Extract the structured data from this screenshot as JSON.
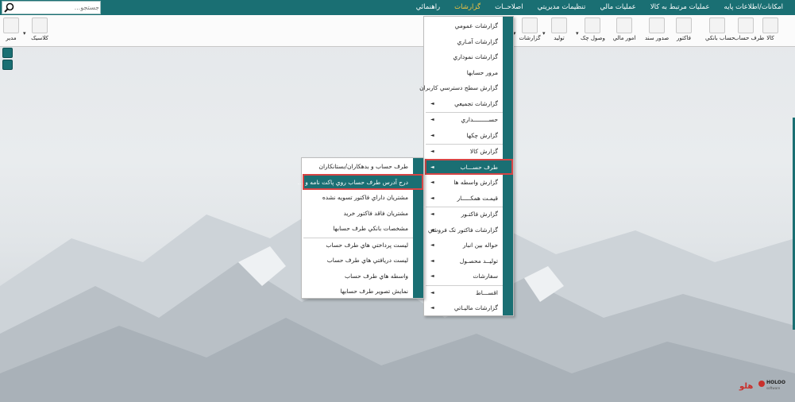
{
  "menubar": {
    "items": [
      {
        "label": "امکانات/اطلاعات پايه",
        "active": false
      },
      {
        "label": "عمليات مرتبط به کالا",
        "active": false
      },
      {
        "label": "عمليات مالي",
        "active": false
      },
      {
        "label": "تنظيمات مديريتي",
        "active": false
      },
      {
        "label": "اصلاحــات",
        "active": false
      },
      {
        "label": "گزارشات",
        "active": true
      },
      {
        "label": "راهنمائي",
        "active": false
      }
    ],
    "search_placeholder": "جستجو..."
  },
  "toolbar": {
    "buttons": [
      {
        "label": "کالا",
        "icon": "box-icon"
      },
      {
        "label": "طرف حساب",
        "icon": "person-icon"
      },
      {
        "label": "حساب بانکي",
        "icon": "bank-card-icon"
      },
      {
        "label": "فاکتور",
        "icon": "invoice-icon"
      },
      {
        "label": "صدور سند",
        "icon": "document-icon"
      },
      {
        "label": "امور مالي",
        "icon": "calculator-icon"
      },
      {
        "label": "وصول چک",
        "icon": "check-envelope-icon"
      },
      {
        "label": "توليد",
        "icon": "production-icon"
      },
      {
        "label": "گزارشات",
        "icon": "report-icon"
      },
      {
        "label": "کلاسيک",
        "icon": "classic-icon"
      },
      {
        "label": "مدير",
        "icon": "manager-icon"
      }
    ]
  },
  "reports_menu": {
    "items": [
      {
        "label": "گزارشات عمومي",
        "submenu": false,
        "sep_after": false
      },
      {
        "label": "گزارشات آمـاري",
        "submenu": false,
        "sep_after": false
      },
      {
        "label": "گزارشات نموداري",
        "submenu": false,
        "sep_after": false
      },
      {
        "label": "مرور حسابها",
        "submenu": false,
        "sep_after": false
      },
      {
        "label": "گزارش سطح دسترسي کاربران",
        "submenu": false,
        "sep_after": false
      },
      {
        "label": "گزارشات تجميعي",
        "submenu": true,
        "sep_after": true
      },
      {
        "label": "حســـــــــداري",
        "submenu": true,
        "sep_after": false
      },
      {
        "label": "گزارش چکها",
        "submenu": true,
        "sep_after": true
      },
      {
        "label": "گزارش کالا",
        "submenu": true,
        "sep_after": false
      },
      {
        "label": "طرف حســـاب",
        "submenu": true,
        "sep_after": false,
        "selected": true
      },
      {
        "label": "گزارش واسطه ها",
        "submenu": true,
        "sep_after": false
      },
      {
        "label": "قيمـت همکـــــار",
        "submenu": true,
        "sep_after": true
      },
      {
        "label": "گزارش فاکتـور",
        "submenu": true,
        "sep_after": false
      },
      {
        "label": "گزارشات فاکتور تک فروشي",
        "submenu": true,
        "sep_after": false
      },
      {
        "label": "حواله بين انبار",
        "submenu": true,
        "sep_after": false
      },
      {
        "label": "توليــد محصـول",
        "submenu": true,
        "sep_after": false
      },
      {
        "label": "سفارشات",
        "submenu": true,
        "sep_after": true
      },
      {
        "label": "اقســـاط",
        "submenu": true,
        "sep_after": false
      },
      {
        "label": "گزارشات ماليـاتي",
        "submenu": true,
        "sep_after": false
      }
    ]
  },
  "account_submenu": {
    "items": [
      {
        "label": "طرف حساب و بدهکاران/بستانکاران",
        "sep_after": false
      },
      {
        "label": "درج آدرس طرف حساب روي پاکت نامه و ...",
        "sep_after": false,
        "selected": true
      },
      {
        "label": "مشتريان داراي فاکتور تسويه نشده",
        "sep_after": false
      },
      {
        "label": "مشتريان فاقد فاکتور خريد",
        "sep_after": false
      },
      {
        "label": "مشخصات بانکي طرف حسابها",
        "sep_after": true
      },
      {
        "label": "ليست پرداختي هاي طرف حساب",
        "sep_after": false
      },
      {
        "label": "ليست دريافتي هاي طرف حساب",
        "sep_after": false
      },
      {
        "label": "واسطه هاي طرف حساب",
        "sep_after": false
      },
      {
        "label": "نمايش تصوير طرف حسابها",
        "sep_after": false
      }
    ]
  },
  "logo": {
    "text": "HOLOO",
    "sub": "software"
  },
  "colors": {
    "teal": "#1a6f73",
    "highlight_border": "#d64545",
    "active_menu": "#f5c542"
  }
}
